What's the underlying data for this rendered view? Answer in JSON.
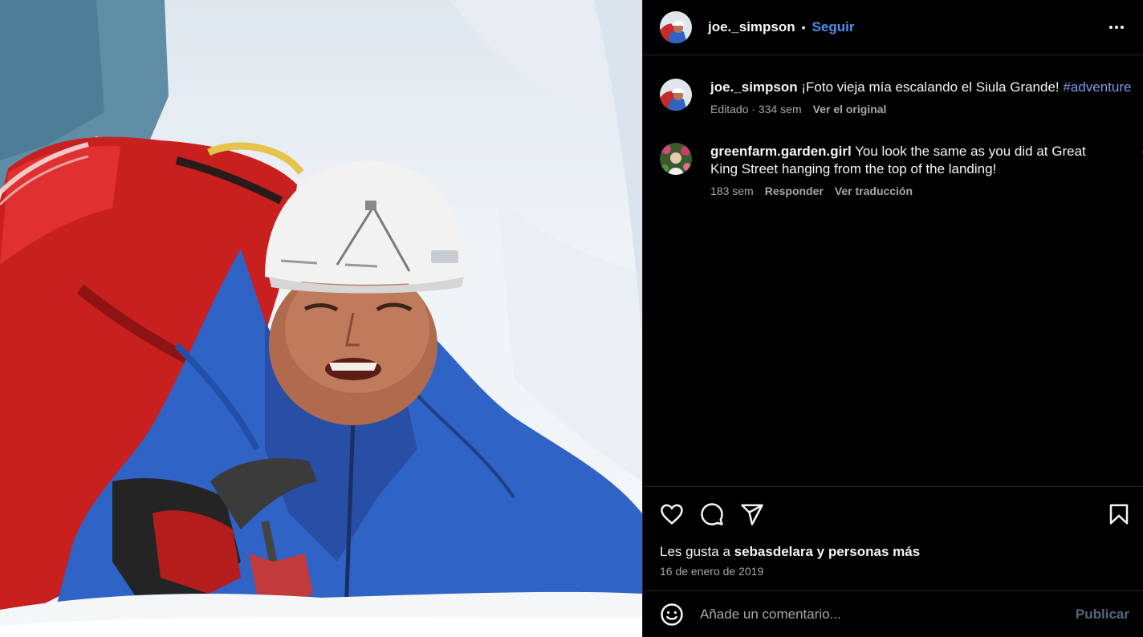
{
  "post": {
    "author": "joe._simpson",
    "separator": "•",
    "follow_label": "Seguir",
    "caption": {
      "username": "joe._simpson",
      "text": " ¡Foto vieja mía escalando el Siula Grande! ",
      "hashtag": "#adventure",
      "edited_label": "Editado · 334 sem",
      "see_original_label": "Ver el original"
    },
    "comments": [
      {
        "username": "greenfarm.garden.girl",
        "text": " You look the same as you did at Great King Street hanging from the top of the landing!",
        "time": "183 sem",
        "reply_label": "Responder",
        "translate_label": "Ver traducción"
      }
    ],
    "likes_prefix": "Les gusta a ",
    "likes_user": "sebasdelara",
    "likes_suffix": " y personas más",
    "date": "16 de enero de 2019"
  },
  "composer": {
    "placeholder": "Añade un comentario...",
    "publish_label": "Publicar"
  },
  "icons": {
    "like": "heart-icon",
    "comment": "comment-icon",
    "share": "share-icon",
    "save": "bookmark-icon",
    "more": "more-options-icon",
    "emoji": "emoji-icon"
  },
  "colors": {
    "accent": "#4a90f0",
    "hashtag": "#7d9bf0",
    "muted": "#a8a8a8",
    "background": "#000000"
  }
}
